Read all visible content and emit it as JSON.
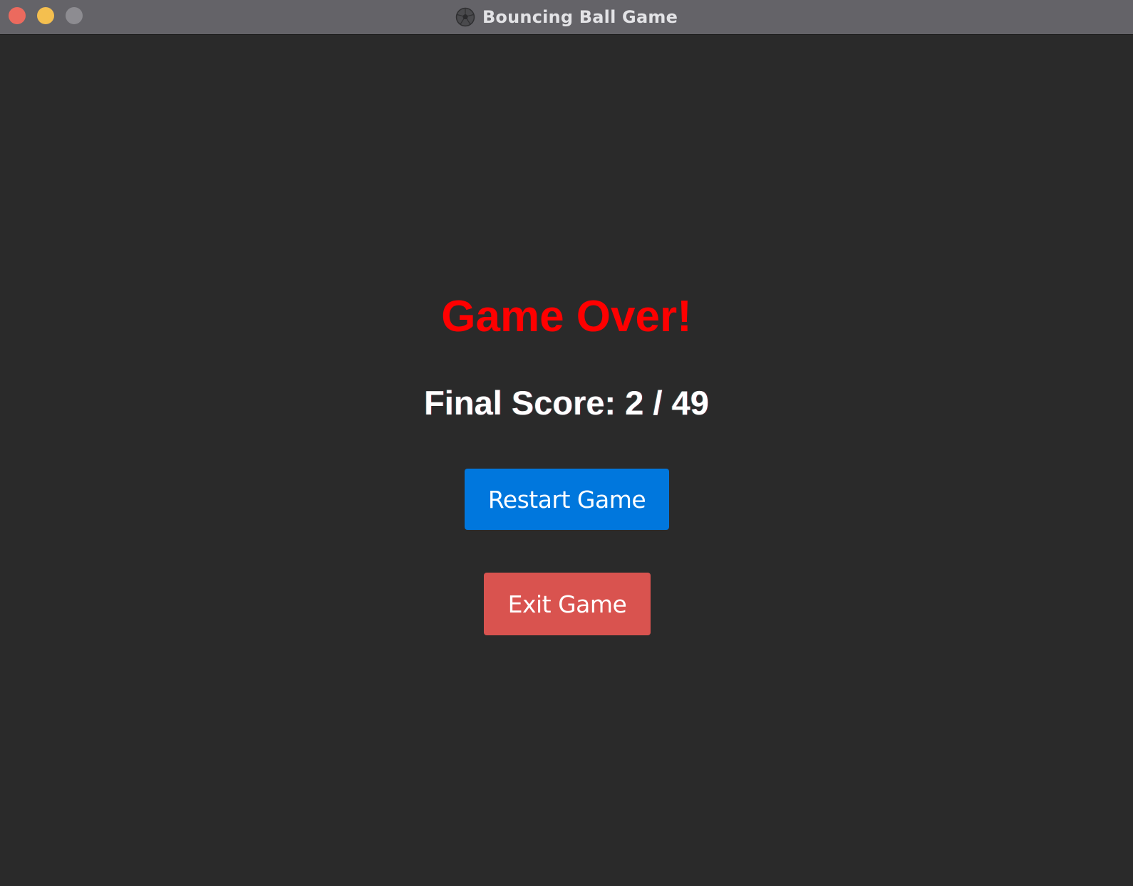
{
  "window": {
    "title": "Bouncing Ball Game",
    "title_icon": "soccer-ball-icon",
    "controls": [
      "close",
      "minimize",
      "zoom"
    ]
  },
  "game": {
    "headline": "Game Over!",
    "score_label": "Final Score:",
    "score": "2",
    "separator": "/",
    "total": "49"
  },
  "buttons": {
    "restart_label": "Restart Game",
    "exit_label": "Exit Game"
  },
  "colors": {
    "background": "#2a2a2a",
    "titlebar": "#646368",
    "headline": "#ff0000",
    "restart_button": "#0077dd",
    "exit_button": "#d9534f",
    "close": "#ec6a5e",
    "minimize": "#f4bf4f",
    "zoom": "#8d8c91"
  }
}
